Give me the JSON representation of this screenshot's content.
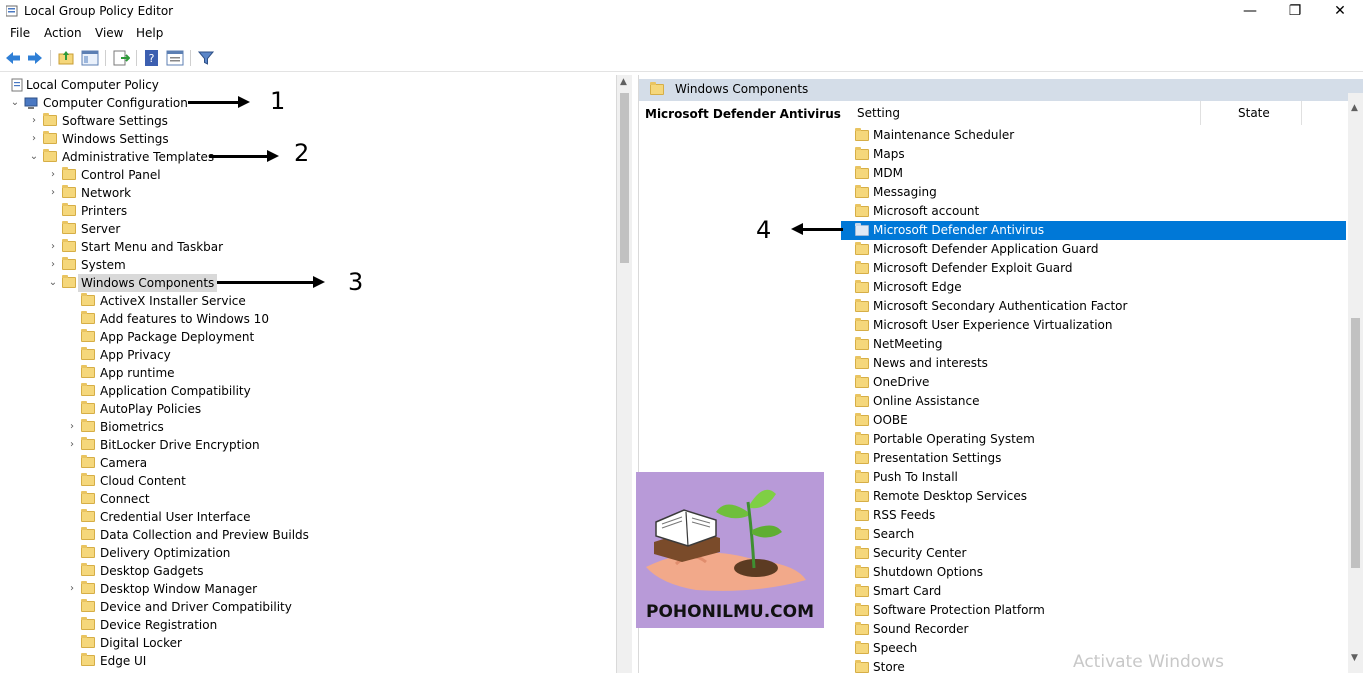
{
  "window": {
    "title": "Local Group Policy Editor",
    "minimize": "—",
    "maximize": "❐",
    "close": "✕"
  },
  "menu": [
    "File",
    "Action",
    "View",
    "Help"
  ],
  "toolbar": {
    "icons": [
      "back-arrow-icon",
      "forward-arrow-icon",
      "up-folder-icon",
      "show-hide-tree-icon",
      "export-list-icon",
      "help-icon",
      "properties-icon",
      "filter-icon"
    ]
  },
  "tree": [
    {
      "label": "Local Computer Policy",
      "level": 0,
      "expander": "",
      "folder": false
    },
    {
      "label": "Computer Configuration",
      "level": 0,
      "expander": "v",
      "folder": false
    },
    {
      "label": "Software Settings",
      "level": 1,
      "expander": ">",
      "folder": true
    },
    {
      "label": "Windows Settings",
      "level": 1,
      "expander": ">",
      "folder": true
    },
    {
      "label": "Administrative Templates",
      "level": 1,
      "expander": "v",
      "folder": true
    },
    {
      "label": "Control Panel",
      "level": 2,
      "expander": ">",
      "folder": true
    },
    {
      "label": "Network",
      "level": 2,
      "expander": ">",
      "folder": true
    },
    {
      "label": "Printers",
      "level": 2,
      "expander": "",
      "folder": true
    },
    {
      "label": "Server",
      "level": 2,
      "expander": "",
      "folder": true
    },
    {
      "label": "Start Menu and Taskbar",
      "level": 2,
      "expander": ">",
      "folder": true
    },
    {
      "label": "System",
      "level": 2,
      "expander": ">",
      "folder": true
    },
    {
      "label": "Windows Components",
      "level": 2,
      "expander": "v",
      "folder": true,
      "selected": true
    },
    {
      "label": "ActiveX Installer Service",
      "level": 3,
      "expander": "",
      "folder": true
    },
    {
      "label": "Add features to Windows 10",
      "level": 3,
      "expander": "",
      "folder": true
    },
    {
      "label": "App Package Deployment",
      "level": 3,
      "expander": "",
      "folder": true
    },
    {
      "label": "App Privacy",
      "level": 3,
      "expander": "",
      "folder": true
    },
    {
      "label": "App runtime",
      "level": 3,
      "expander": "",
      "folder": true
    },
    {
      "label": "Application Compatibility",
      "level": 3,
      "expander": "",
      "folder": true
    },
    {
      "label": "AutoPlay Policies",
      "level": 3,
      "expander": "",
      "folder": true
    },
    {
      "label": "Biometrics",
      "level": 3,
      "expander": ">",
      "folder": true
    },
    {
      "label": "BitLocker Drive Encryption",
      "level": 3,
      "expander": ">",
      "folder": true
    },
    {
      "label": "Camera",
      "level": 3,
      "expander": "",
      "folder": true
    },
    {
      "label": "Cloud Content",
      "level": 3,
      "expander": "",
      "folder": true
    },
    {
      "label": "Connect",
      "level": 3,
      "expander": "",
      "folder": true
    },
    {
      "label": "Credential User Interface",
      "level": 3,
      "expander": "",
      "folder": true
    },
    {
      "label": "Data Collection and Preview Builds",
      "level": 3,
      "expander": "",
      "folder": true
    },
    {
      "label": "Delivery Optimization",
      "level": 3,
      "expander": "",
      "folder": true
    },
    {
      "label": "Desktop Gadgets",
      "level": 3,
      "expander": "",
      "folder": true
    },
    {
      "label": "Desktop Window Manager",
      "level": 3,
      "expander": ">",
      "folder": true
    },
    {
      "label": "Device and Driver Compatibility",
      "level": 3,
      "expander": "",
      "folder": true
    },
    {
      "label": "Device Registration",
      "level": 3,
      "expander": "",
      "folder": true
    },
    {
      "label": "Digital Locker",
      "level": 3,
      "expander": "",
      "folder": true
    },
    {
      "label": "Edge UI",
      "level": 3,
      "expander": "",
      "folder": true
    }
  ],
  "right": {
    "header_title": "Windows Components",
    "extended_title": "Microsoft Defender Antivirus",
    "col_setting": "Setting",
    "col_state": "State",
    "items": [
      {
        "label": "Maintenance Scheduler"
      },
      {
        "label": "Maps"
      },
      {
        "label": "MDM"
      },
      {
        "label": "Messaging"
      },
      {
        "label": "Microsoft account"
      },
      {
        "label": "Microsoft Defender Antivirus",
        "selected": true
      },
      {
        "label": "Microsoft Defender Application Guard"
      },
      {
        "label": "Microsoft Defender Exploit Guard"
      },
      {
        "label": "Microsoft Edge"
      },
      {
        "label": "Microsoft Secondary Authentication Factor"
      },
      {
        "label": "Microsoft User Experience Virtualization"
      },
      {
        "label": "NetMeeting"
      },
      {
        "label": "News and interests"
      },
      {
        "label": "OneDrive"
      },
      {
        "label": "Online Assistance"
      },
      {
        "label": "OOBE"
      },
      {
        "label": "Portable Operating System"
      },
      {
        "label": "Presentation Settings"
      },
      {
        "label": "Push To Install"
      },
      {
        "label": "Remote Desktop Services"
      },
      {
        "label": "RSS Feeds"
      },
      {
        "label": "Search"
      },
      {
        "label": "Security Center"
      },
      {
        "label": "Shutdown Options"
      },
      {
        "label": "Smart Card"
      },
      {
        "label": "Software Protection Platform"
      },
      {
        "label": "Sound Recorder"
      },
      {
        "label": "Speech"
      },
      {
        "label": "Store"
      }
    ]
  },
  "annotations": [
    "1",
    "2",
    "3",
    "4"
  ],
  "watermark": {
    "logo_text": "POHONILMU.COM",
    "activate_text": "Activate Windows"
  },
  "colors": {
    "selection": "#0078d7",
    "header": "#d4dde8",
    "folder": "#f5d77b"
  }
}
